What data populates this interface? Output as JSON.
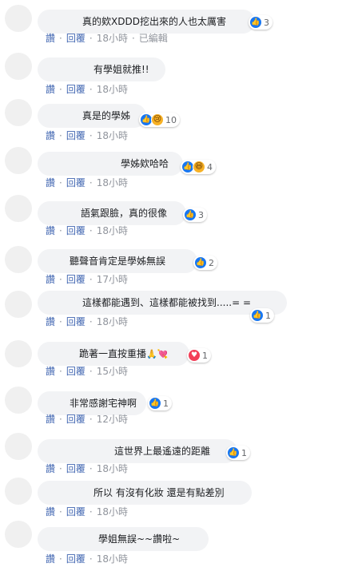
{
  "comments": [
    {
      "text": "真的欸XDDD挖出來的人也太厲害",
      "reactions": [
        "like"
      ],
      "count": "3",
      "like": "讚",
      "reply": "回覆",
      "time": "18小時",
      "edited": "已編輯"
    },
    {
      "text": "有學姐就推!!",
      "reactions": [],
      "count": "",
      "like": "讚",
      "reply": "回覆",
      "time": "18小時"
    },
    {
      "text": "真是的學姊",
      "reactions": [
        "like",
        "sad"
      ],
      "count": "10",
      "like": "讚",
      "reply": "回覆",
      "time": "18小時"
    },
    {
      "text": "學姊欸哈哈",
      "reactions": [
        "like",
        "haha"
      ],
      "count": "4",
      "like": "讚",
      "reply": "回覆",
      "time": "18小時"
    },
    {
      "text": "語氣跟臉，真的很像",
      "reactions": [
        "like"
      ],
      "count": "3",
      "like": "讚",
      "reply": "回覆",
      "time": "18小時"
    },
    {
      "text": "聽聲音肯定是學姊無誤",
      "reactions": [
        "like"
      ],
      "count": "2",
      "like": "讚",
      "reply": "回覆",
      "time": "17小時"
    },
    {
      "text": "這樣都能遇到、這樣都能被找到.....= =",
      "reactions": [
        "like"
      ],
      "count": "1",
      "like": "讚",
      "reply": "回覆",
      "time": "18小時"
    },
    {
      "text": "跪著一直按重播",
      "emoji": "🙏💘",
      "reactions": [
        "heart"
      ],
      "count": "1",
      "like": "讚",
      "reply": "回覆",
      "time": "15小時"
    },
    {
      "text": "非常感謝宅神啊",
      "reactions": [
        "like"
      ],
      "count": "1",
      "like": "讚",
      "reply": "回覆",
      "time": "12小時"
    },
    {
      "text": "這世界上最遙遠的距離",
      "reactions": [
        "like"
      ],
      "count": "1",
      "like": "讚",
      "reply": "回覆",
      "time": "18小時"
    },
    {
      "text": "所以 有沒有化妝 還是有點差別",
      "reactions": [],
      "count": "",
      "like": "讚",
      "reply": "回覆",
      "time": "18小時"
    },
    {
      "text": "學姐無誤~~讚啦~",
      "reactions": [],
      "count": "",
      "like": "讚",
      "reply": "回覆",
      "time": "18小時"
    }
  ]
}
